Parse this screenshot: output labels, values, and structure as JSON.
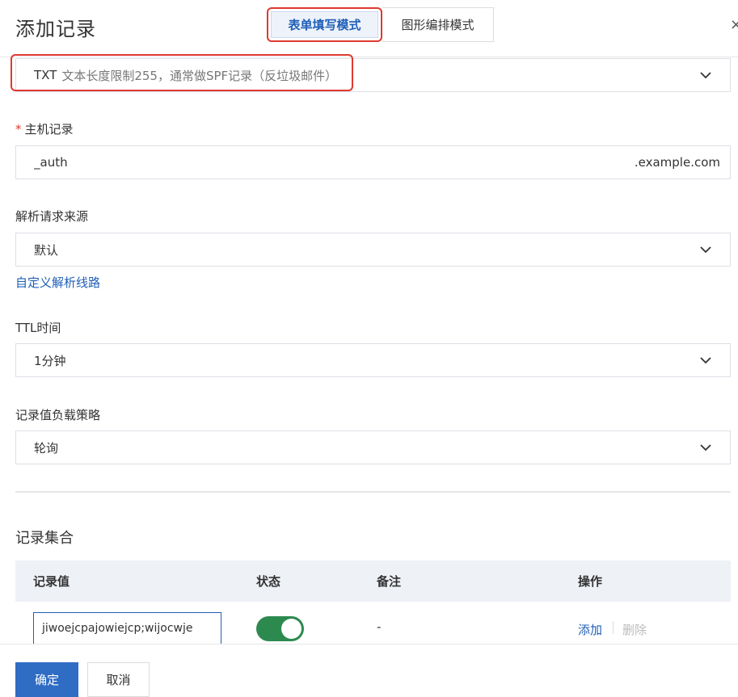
{
  "dialog": {
    "title": "添加记录",
    "close": "×"
  },
  "modes": {
    "form": "表单填写模式",
    "graph": "图形编排模式"
  },
  "record_type": {
    "code": "TXT",
    "description": "文本长度限制255，通常做SPF记录（反垃圾邮件）"
  },
  "host": {
    "label": "主机记录",
    "required_mark": "*",
    "value": "_auth",
    "suffix": ".example.com"
  },
  "source": {
    "label": "解析请求来源",
    "value": "默认",
    "custom_link": "自定义解析线路"
  },
  "ttl": {
    "label": "TTL时间",
    "value": "1分钟"
  },
  "strategy": {
    "label": "记录值负载策略",
    "value": "轮询"
  },
  "records": {
    "title": "记录集合",
    "columns": [
      "记录值",
      "状态",
      "备注",
      "操作"
    ],
    "rows": [
      {
        "value": "jiwoejcpajowiejcp;wijocwje",
        "status_on": true,
        "note": "-",
        "add": "添加",
        "delete": "删除"
      }
    ]
  },
  "footer": {
    "ok": "确定",
    "cancel": "取消"
  },
  "colors": {
    "accent": "#2f6cc4",
    "link": "#1f5fb7",
    "highlight": "#e0392f",
    "toggle_on": "#2d8a4f"
  }
}
